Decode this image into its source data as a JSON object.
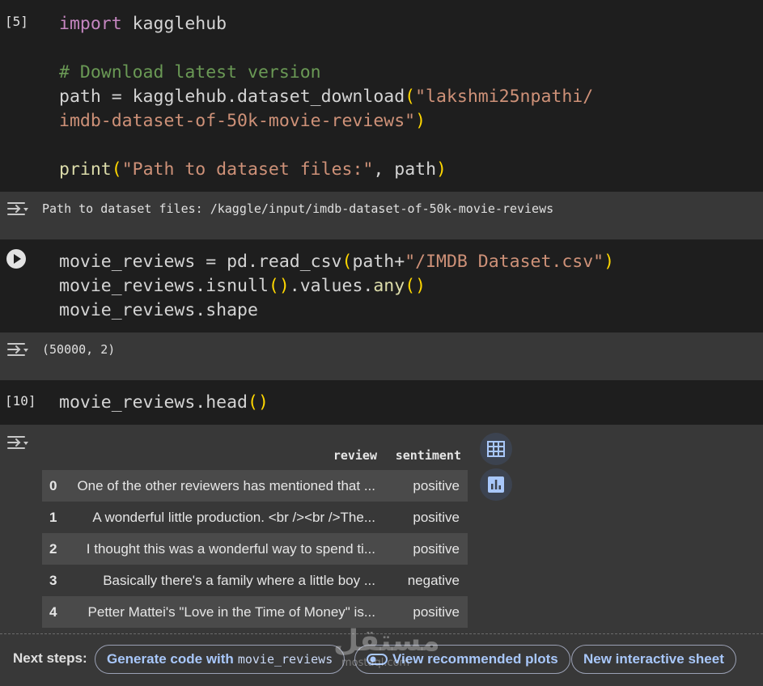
{
  "cells": [
    {
      "exec_count": "[5]",
      "code_lines": [
        [
          [
            "kw",
            "import"
          ],
          [
            "",
            " kagglehub"
          ]
        ],
        [],
        [
          [
            "cm",
            "# Download latest version"
          ]
        ],
        [
          [
            "",
            "path = kagglehub.dataset_download"
          ],
          [
            "par",
            "("
          ],
          [
            "st",
            "\"lakshmi25npathi/"
          ]
        ],
        [
          [
            "st",
            "imdb-dataset-of-50k-movie-reviews\""
          ],
          [
            "par",
            ")"
          ]
        ],
        [],
        [
          [
            "fn",
            "print"
          ],
          [
            "par",
            "("
          ],
          [
            "st",
            "\"Path to dataset files:\""
          ],
          [
            "",
            ", path"
          ],
          [
            "par",
            ")"
          ]
        ]
      ],
      "output": "Path to dataset files: /kaggle/input/imdb-dataset-of-50k-movie-reviews"
    },
    {
      "exec_count": "",
      "code_lines": [
        [
          [
            "",
            "movie_reviews = pd.read_csv"
          ],
          [
            "par",
            "("
          ],
          [
            "",
            "path+"
          ],
          [
            "st",
            "\"/IMDB Dataset.csv\""
          ],
          [
            "par",
            ")"
          ]
        ],
        [
          [
            "",
            "movie_reviews.isnull"
          ],
          [
            "par",
            "()"
          ],
          [
            "",
            ".values."
          ],
          [
            "fn",
            "any"
          ],
          [
            "par",
            "()"
          ]
        ],
        [
          [
            "",
            "movie_reviews.shape"
          ]
        ]
      ],
      "output": "(50000, 2)"
    },
    {
      "exec_count": "[10]",
      "code_lines": [
        [
          [
            "",
            "movie_reviews.head"
          ],
          [
            "par",
            "()"
          ]
        ]
      ]
    }
  ],
  "dataframe": {
    "columns": [
      "review",
      "sentiment"
    ],
    "rows": [
      {
        "index": "0",
        "review": "One of the other reviewers has mentioned that ...",
        "sentiment": "positive"
      },
      {
        "index": "1",
        "review": "A wonderful little production. <br /><br />The...",
        "sentiment": "positive"
      },
      {
        "index": "2",
        "review": "I thought this was a wonderful way to spend ti...",
        "sentiment": "positive"
      },
      {
        "index": "3",
        "review": "Basically there's a family where a little boy ...",
        "sentiment": "negative"
      },
      {
        "index": "4",
        "review": "Petter Mattei's \"Love in the Time of Money\" is...",
        "sentiment": "positive"
      }
    ]
  },
  "side_icons": [
    "table-view-icon",
    "chart-suggest-icon"
  ],
  "next_steps": {
    "label": "Next steps:",
    "chip1_text": "Generate code with",
    "chip1_var": "movie_reviews",
    "chip2": "View recommended plots",
    "chip3": "New interactive sheet"
  },
  "watermark": {
    "arabic": "مستقل",
    "latin": "mostaql.com"
  }
}
